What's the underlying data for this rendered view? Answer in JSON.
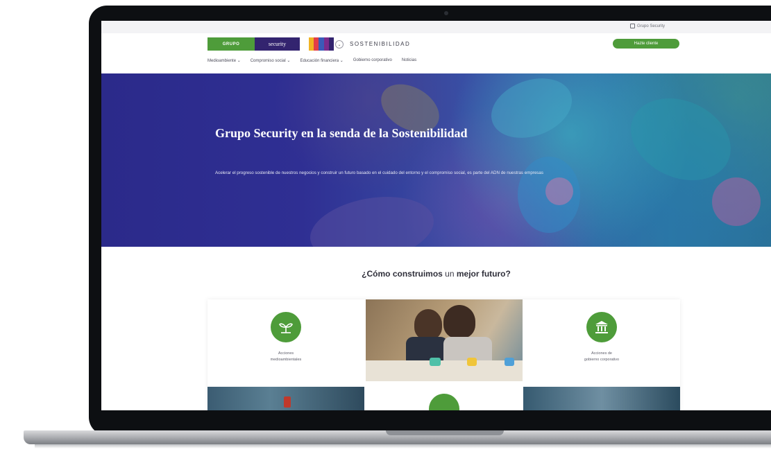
{
  "header": {
    "top_link": "Grupo Security",
    "logo_left": "GRUPO",
    "logo_right": "security",
    "site_name": "SOSTENIBILIDAD",
    "cta_label": "Hazte cliente",
    "brand_colors": [
      "#4e9c3a",
      "#33246f",
      "#f0b323",
      "#e23d48",
      "#3a5bb8",
      "#7a2c8c"
    ]
  },
  "nav": {
    "items": [
      {
        "label": "Medioambiente ⌄"
      },
      {
        "label": "Compromiso social ⌄"
      },
      {
        "label": "Educación financiera ⌄"
      },
      {
        "label": "Gobierno corporativo"
      },
      {
        "label": "Noticias"
      }
    ]
  },
  "hero": {
    "title": "Grupo Security en la senda de la Sostenibilidad",
    "subtitle": "Acelerar el progreso sostenible de nuestros negocios y construir un futuro basado en el cuidado del entorno y el compromiso social, es parte del ADN de nuestras empresas"
  },
  "section": {
    "title_pre": "¿Cómo construimos",
    "title_mid": " un ",
    "title_post": "mejor futuro?",
    "cards": [
      {
        "label_line1": "Acciones",
        "label_line2": "medioambientales",
        "icon": "plant-icon"
      },
      {
        "label_line1": "Acciones de",
        "label_line2": "gobierno corporativo",
        "icon": "building-icon"
      }
    ]
  }
}
